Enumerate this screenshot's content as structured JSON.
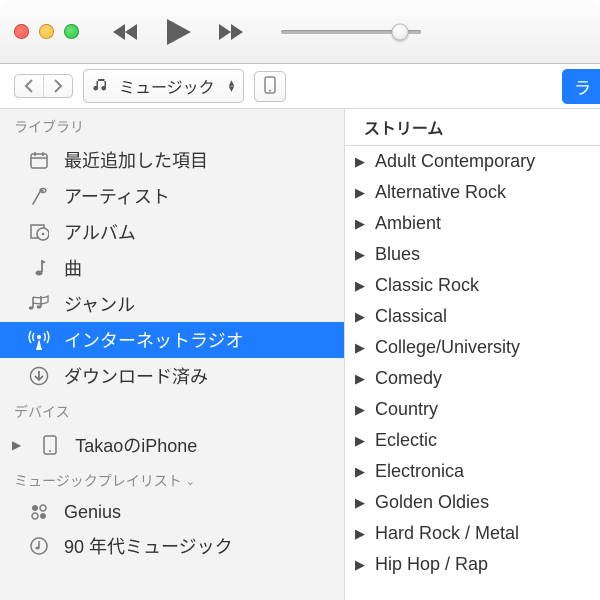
{
  "volume_percent": 85,
  "category_selector_label": "ミュージック",
  "right_pill_label": "ラ",
  "sidebar": {
    "library_header": "ライブラリ",
    "devices_header": "デバイス",
    "playlists_header": "ミュージックプレイリスト",
    "items": [
      {
        "id": "recent",
        "label": "最近追加した項目"
      },
      {
        "id": "artists",
        "label": "アーティスト"
      },
      {
        "id": "albums",
        "label": "アルバム"
      },
      {
        "id": "songs",
        "label": "曲"
      },
      {
        "id": "genres",
        "label": "ジャンル"
      },
      {
        "id": "radio",
        "label": "インターネットラジオ",
        "selected": true
      },
      {
        "id": "down",
        "label": "ダウンロード済み"
      }
    ],
    "device_name": "TakaoのiPhone",
    "playlists": [
      {
        "id": "genius",
        "label": "Genius"
      },
      {
        "id": "90s",
        "label": "90 年代ミュージック"
      }
    ]
  },
  "streams_header": "ストリーム",
  "streams": [
    "Adult Contemporary",
    "Alternative Rock",
    "Ambient",
    "Blues",
    "Classic Rock",
    "Classical",
    "College/University",
    "Comedy",
    "Country",
    "Eclectic",
    "Electronica",
    "Golden Oldies",
    "Hard Rock / Metal",
    "Hip Hop / Rap"
  ]
}
